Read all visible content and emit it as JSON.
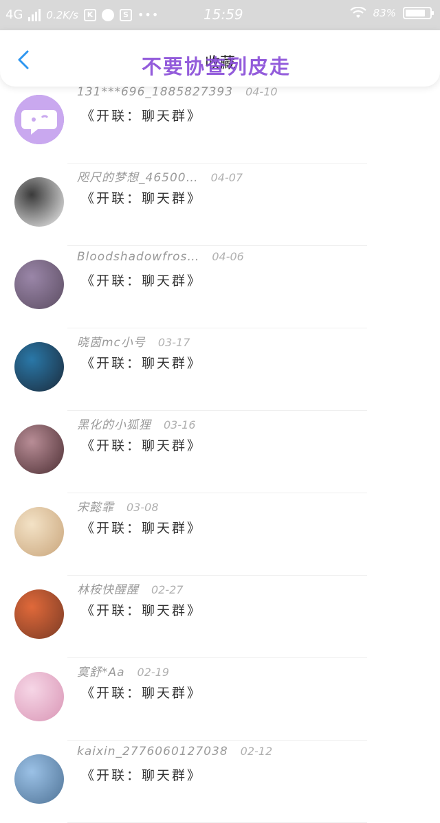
{
  "status_bar": {
    "network": "4G",
    "speed": "0.2K/s",
    "app_icon_k": "K",
    "app_icon_s": "S",
    "more": "•••",
    "time": "15:59",
    "battery": "83%",
    "battery_level": 0.83
  },
  "header": {
    "title": "收藏",
    "overlay_text": "不要协查列皮走",
    "back_icon": "chevron-left-icon"
  },
  "items": [
    {
      "name": "131***696_1885827393",
      "date": "04-10",
      "message": "《开联：聊天群》",
      "avatar_colors": [
        "#c9a8ef",
        "#a37be0"
      ]
    },
    {
      "name": "咫尺的梦想_46500…",
      "date": "04-07",
      "message": "《开联：聊天群》",
      "avatar_colors": [
        "#3a3a3a",
        "#f1f1f1"
      ]
    },
    {
      "name": "Bloodshadowfros…",
      "date": "04-06",
      "message": "《开联：聊天群》",
      "avatar_colors": [
        "#9a86a8",
        "#5c4d62"
      ]
    },
    {
      "name": "晓茵mc小号",
      "date": "03-17",
      "message": "《开联：聊天群》",
      "avatar_colors": [
        "#2a78a8",
        "#1b2b3c"
      ]
    },
    {
      "name": "黑化的小狐狸",
      "date": "03-16",
      "message": "《开联：聊天群》",
      "avatar_colors": [
        "#b88d96",
        "#4d2f34"
      ]
    },
    {
      "name": "宋懿霏",
      "date": "03-08",
      "message": "《开联：聊天群》",
      "avatar_colors": [
        "#f3e2c6",
        "#c9a57b"
      ]
    },
    {
      "name": "林桉快醒醒",
      "date": "02-27",
      "message": "《开联：聊天群》",
      "avatar_colors": [
        "#e0693a",
        "#7a3b25"
      ]
    },
    {
      "name": "寞舒*Aa",
      "date": "02-19",
      "message": "《开联：聊天群》",
      "avatar_colors": [
        "#f6d6e6",
        "#d995b5"
      ]
    },
    {
      "name": "kaixin_2776060127038",
      "date": "02-12",
      "message": "《开联：聊天群》",
      "avatar_colors": [
        "#9bc1e6",
        "#4f7396"
      ]
    }
  ]
}
